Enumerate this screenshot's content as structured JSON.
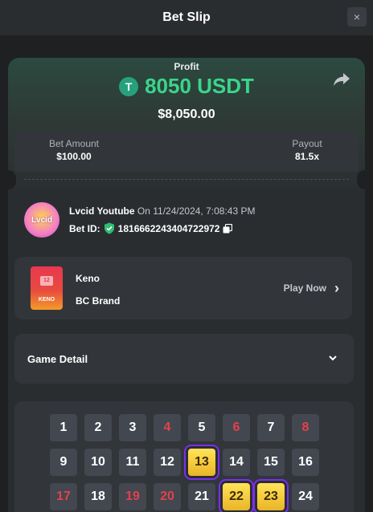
{
  "header": {
    "title": "Bet Slip",
    "close_label": "×"
  },
  "profit": {
    "label": "Profit",
    "amount": "8050 USDT",
    "usd_value": "$8,050.00",
    "currency_icon": "usdt-tether-icon",
    "currency_icon_glyph": "T"
  },
  "stats": {
    "bet_amount_label": "Bet Amount",
    "bet_amount_value": "$100.00",
    "payout_label": "Payout",
    "payout_value": "81.5x"
  },
  "user": {
    "avatar_text": "Lvcid",
    "name": "Lvcid Youtube",
    "date": "On 11/24/2024, 7:08:43 PM",
    "bet_id_label": "Bet ID:",
    "bet_id_value": "1816662243404722972"
  },
  "game": {
    "thumb_tile": "12",
    "thumb_word": "KENO",
    "name": "Keno",
    "brand": "BC Brand",
    "play_now_label": "Play Now",
    "play_now_chevron": "›"
  },
  "detail": {
    "title": "Game Detail"
  },
  "board": {
    "rows": [
      [
        {
          "n": "1"
        },
        {
          "n": "2"
        },
        {
          "n": "3"
        },
        {
          "n": "4",
          "red": true
        },
        {
          "n": "5"
        },
        {
          "n": "6",
          "red": true
        },
        {
          "n": "7"
        },
        {
          "n": "8",
          "red": true
        }
      ],
      [
        {
          "n": "9"
        },
        {
          "n": "10"
        },
        {
          "n": "11"
        },
        {
          "n": "12"
        },
        {
          "n": "13",
          "hit": true
        },
        {
          "n": "14"
        },
        {
          "n": "15"
        },
        {
          "n": "16"
        }
      ],
      [
        {
          "n": "17",
          "red": true
        },
        {
          "n": "18"
        },
        {
          "n": "19",
          "red": true
        },
        {
          "n": "20",
          "red": true
        },
        {
          "n": "21"
        },
        {
          "n": "22",
          "hit": true
        },
        {
          "n": "23",
          "hit": true
        },
        {
          "n": "24"
        }
      ]
    ]
  },
  "colors": {
    "profit_green": "#3bd58c",
    "miss_red": "#e5414a",
    "hit_gold": "#f3c73a",
    "hit_ring": "#7b2ef0",
    "panel": "#32363a",
    "background": "#1e2022"
  }
}
